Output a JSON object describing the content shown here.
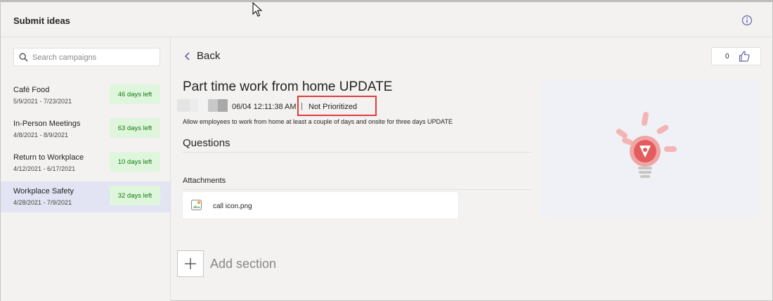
{
  "app": {
    "title": "Submit ideas"
  },
  "sidebar": {
    "search_placeholder": "Search campaigns",
    "campaigns": [
      {
        "name": "Café Food",
        "dates": "5/9/2021 - 7/23/2021",
        "days_left": "46 days left"
      },
      {
        "name": "In-Person Meetings",
        "dates": "4/8/2021 - 8/9/2021",
        "days_left": "63 days left"
      },
      {
        "name": "Return to Workplace",
        "dates": "4/12/2021 - 6/17/2021",
        "days_left": "10 days left"
      },
      {
        "name": "Workplace Safety",
        "dates": "4/28/2021 - 7/9/2021",
        "days_left": "32 days left"
      }
    ],
    "active_index": 3
  },
  "main": {
    "back_label": "Back",
    "like_count": "0",
    "idea": {
      "title": "Part time work from home UPDATE",
      "timestamp": "06/04 12:11:38 AM",
      "separator": "|",
      "status": "Not Prioritized",
      "description": "Allow employees to work from home at least a couple of days and onsite for three days UPDATE"
    },
    "questions_label": "Questions",
    "attachments_label": "Attachments",
    "attachment_file": "call icon.png",
    "add_section_label": "Add section"
  },
  "colors": {
    "accent": "#6264a7",
    "days_badge_bg": "#dff6dd",
    "days_badge_text": "#107c10",
    "highlight_box": "#e03c3c",
    "active_row": "#e2e3f3"
  }
}
